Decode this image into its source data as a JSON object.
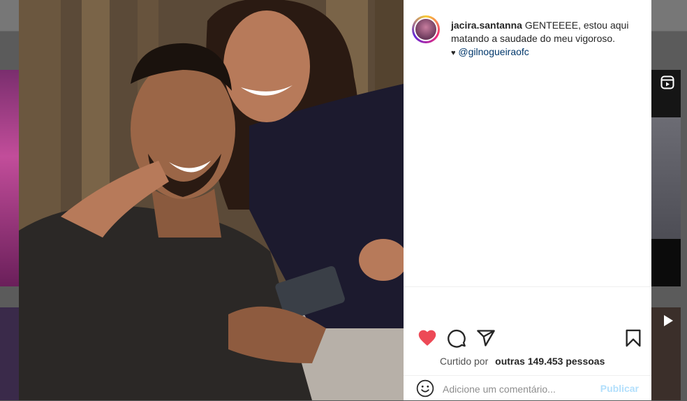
{
  "post": {
    "username": "jacira.santanna",
    "caption_text": "GENTEEEE, estou aqui matando a saudade do meu vigoroso.",
    "heart": "♥",
    "mention": "@gilnogueiraofc"
  },
  "actions": {
    "like_icon": "heart-filled-icon",
    "comment_icon": "comment-icon",
    "share_icon": "send-icon",
    "save_icon": "bookmark-icon"
  },
  "likes": {
    "liked_by_label": "Curtido por",
    "others_label": "outras 149.453 pessoas"
  },
  "comment": {
    "placeholder": "Adicione um comentário...",
    "publish_label": "Publicar"
  },
  "colors": {
    "like_red": "#ed4956",
    "text": "#262626",
    "mention": "#00376b",
    "publish_disabled": "#b2dffc"
  }
}
